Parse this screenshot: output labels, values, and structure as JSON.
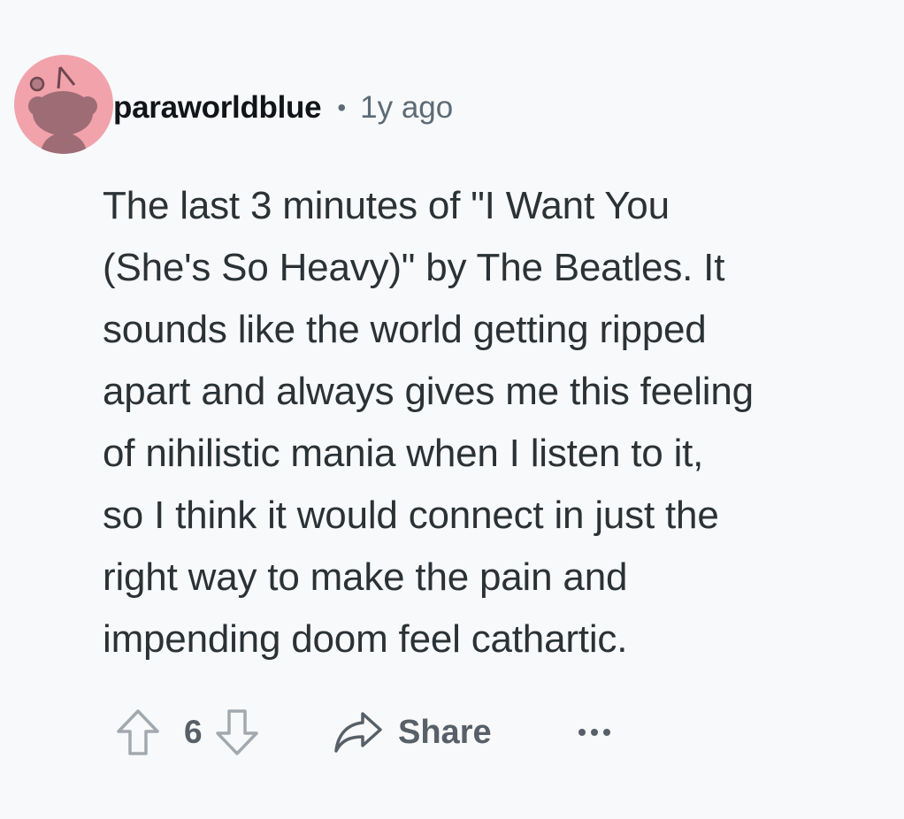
{
  "comment": {
    "author": "paraworldblue",
    "separator": "•",
    "timestamp": "1y ago",
    "body_lines": [
      "The last 3 minutes of \"I Want You",
      "(She's So Heavy)\" by The Beatles. It",
      "sounds like the world getting ripped",
      "apart and always gives me this feeling",
      "of nihilistic mania when I listen to it,",
      "so I think it would connect in just the",
      "right way to make the pain and",
      "impending doom feel cathartic."
    ]
  },
  "actions": {
    "upvote_icon": "arrow-up-outline-icon",
    "vote_count": "6",
    "downvote_icon": "arrow-down-outline-icon",
    "share_icon": "share-arrow-icon",
    "share_label": "Share",
    "more_icon": "ellipsis-icon"
  },
  "colors": {
    "background": "#f8f9fa",
    "avatar_background": "#f1a2ab",
    "username": "#111418",
    "meta_text": "#5c6b76",
    "body_text": "#2b3236",
    "action_text": "#576069"
  }
}
